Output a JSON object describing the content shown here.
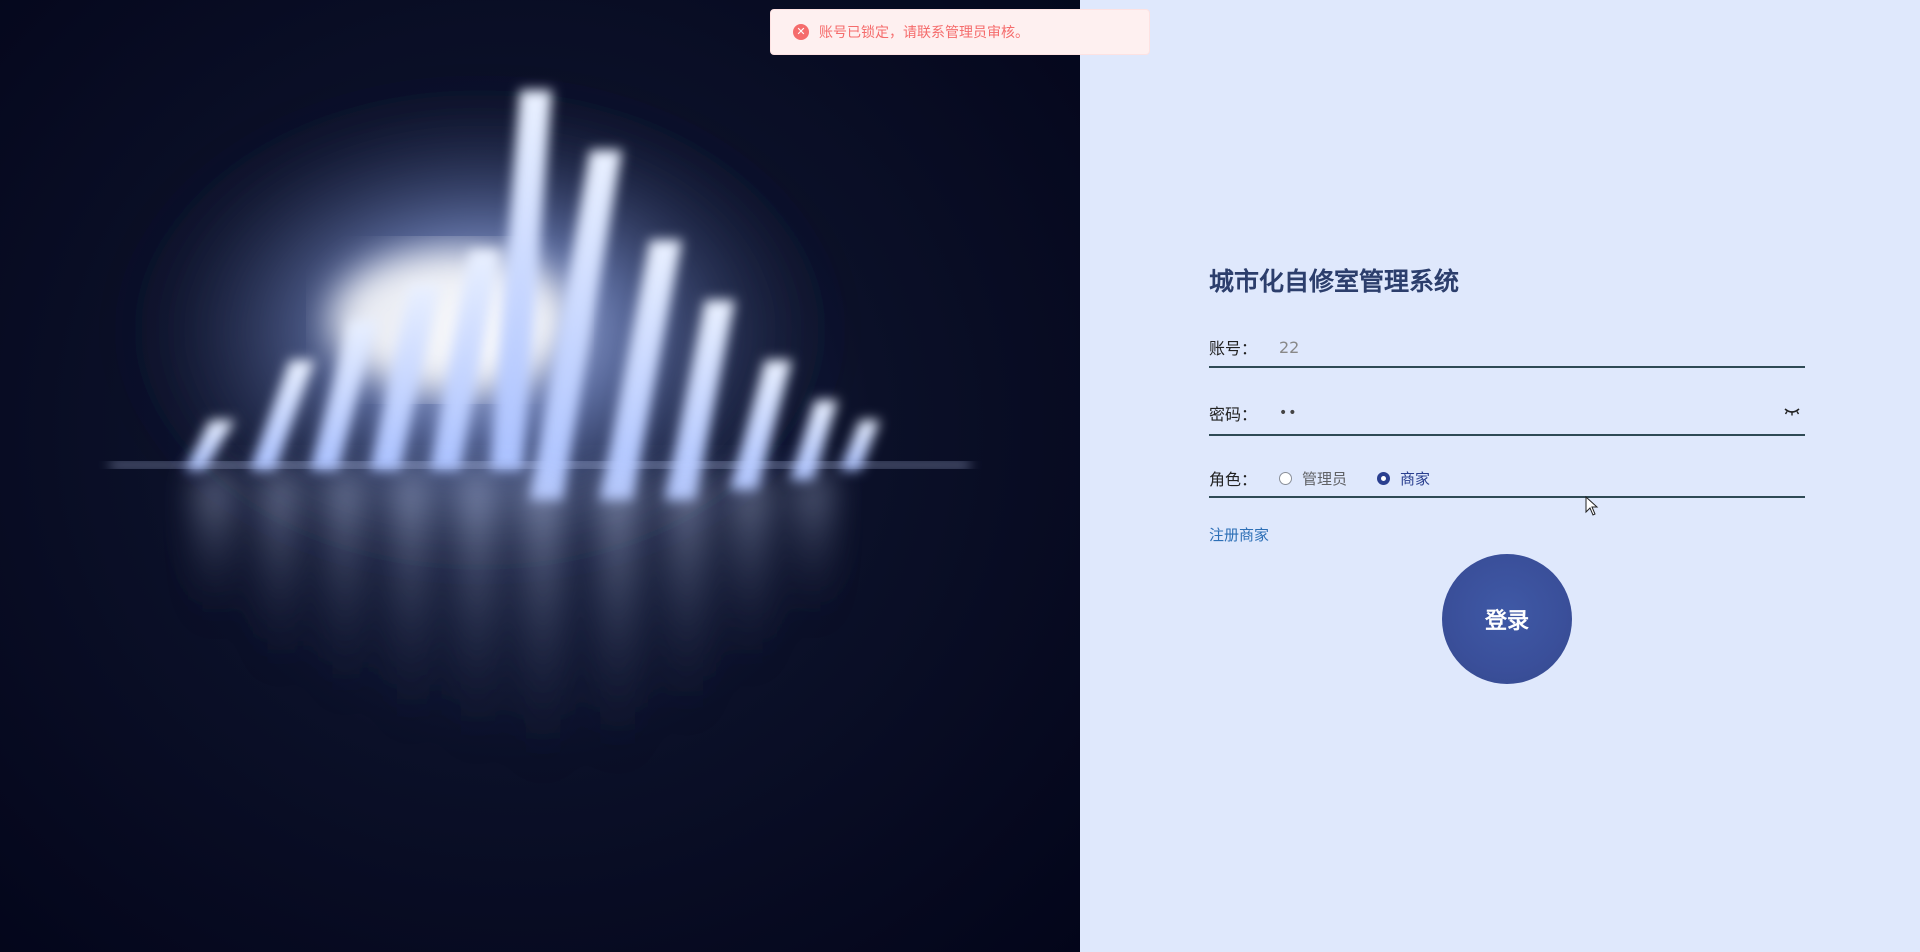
{
  "toast": {
    "icon": "error-circle-icon",
    "message": "账号已锁定，请联系管理员审核。",
    "color": "#f56c6c"
  },
  "login": {
    "title": "城市化自修室管理系统",
    "account_label": "账号：",
    "account_value": "22",
    "password_label": "密码：",
    "password_masked": "••",
    "password_toggle_icon": "eye-closed-icon",
    "role_label": "角色：",
    "roles": [
      {
        "label": "管理员",
        "checked": false
      },
      {
        "label": "商家",
        "checked": true
      }
    ],
    "register_link": "注册商家",
    "submit_label": "登录"
  },
  "colors": {
    "background": "#dfe8fc",
    "title": "#2c3e6c",
    "button": "#3a4f9a",
    "link": "#2d6fb6",
    "underline": "#2f4a55"
  }
}
